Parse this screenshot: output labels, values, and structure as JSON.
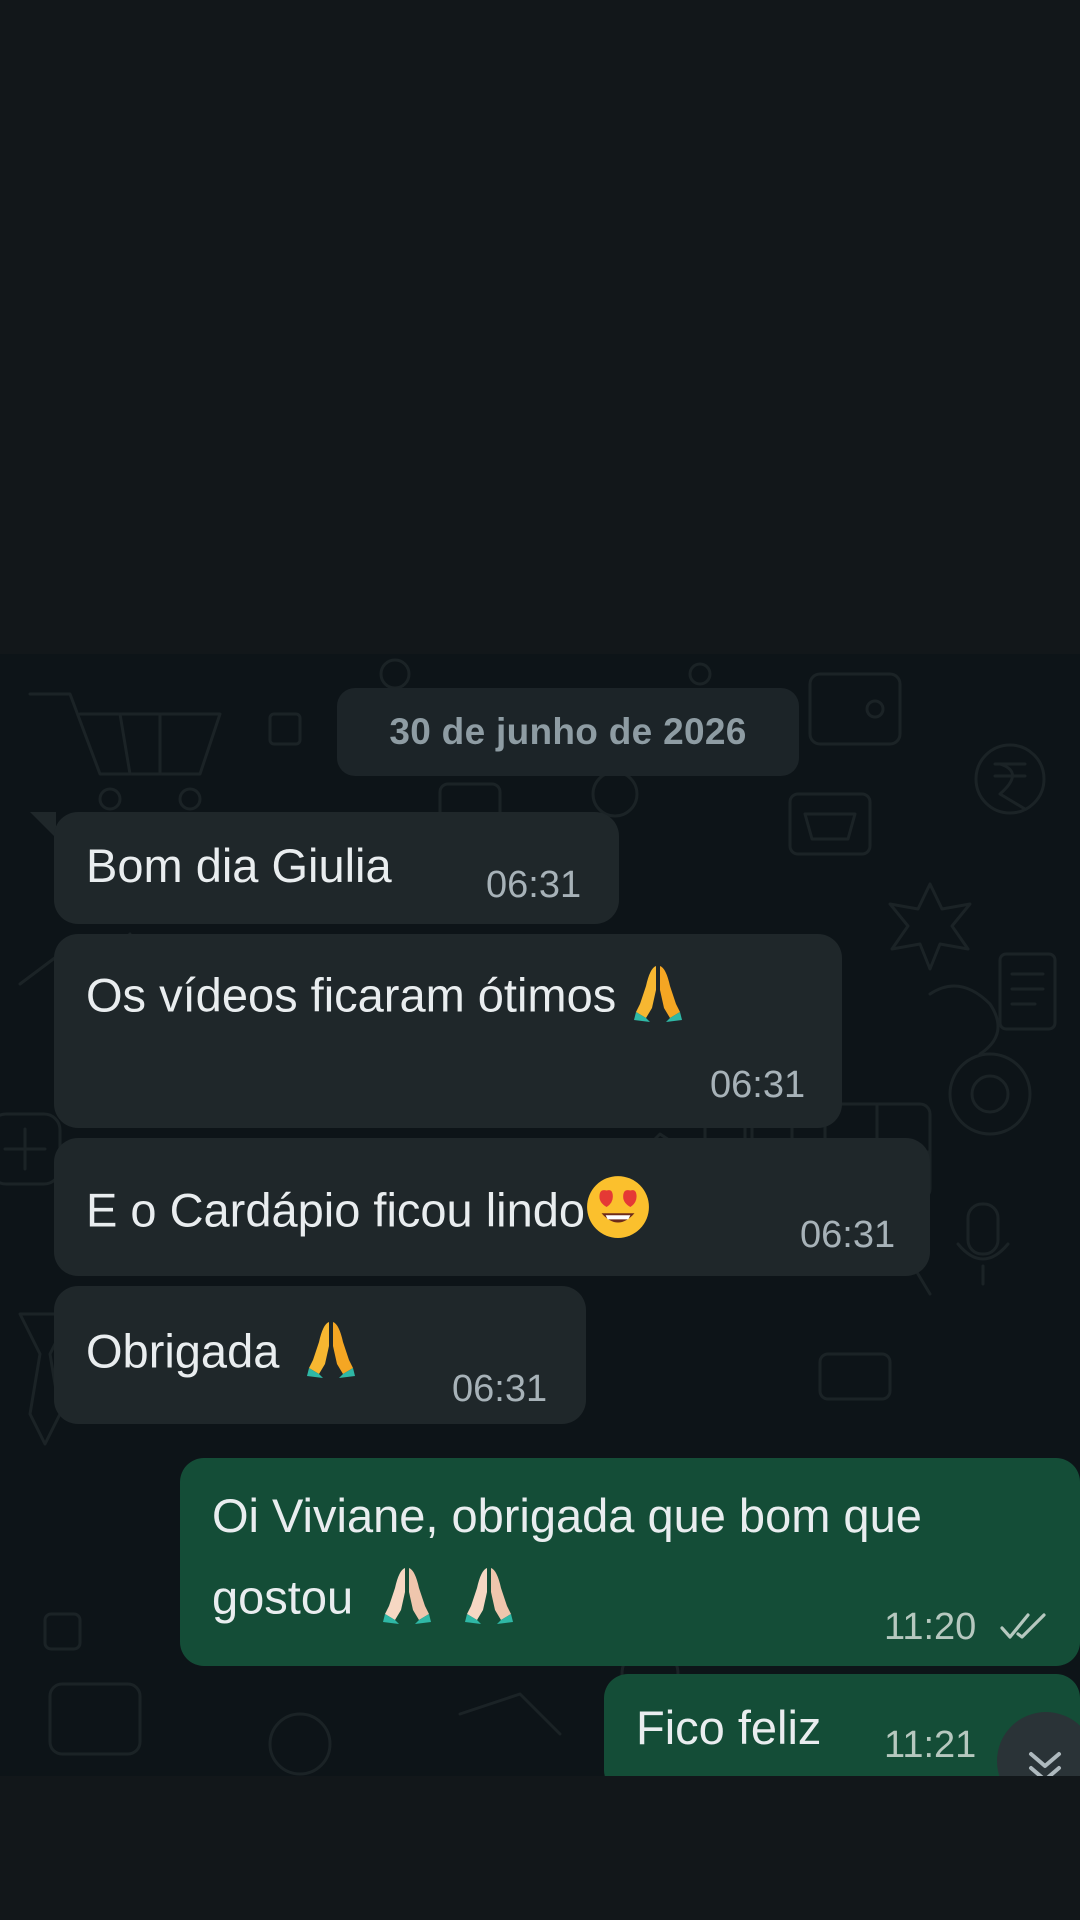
{
  "chat": {
    "date_chip": "30 de junho de 2026",
    "messages": [
      {
        "direction": "in",
        "text": "Bom dia Giulia",
        "time": "06:31"
      },
      {
        "direction": "in",
        "text": "Os vídeos ficaram ótimos",
        "emoji": "folded-hands-emoji",
        "time": "06:31"
      },
      {
        "direction": "in",
        "text": "E o Cardápio ficou lindo",
        "emoji": "heart-eyes-emoji",
        "time": "06:31"
      },
      {
        "direction": "in",
        "text": "Obrigada",
        "emoji": "folded-hands-emoji",
        "time": "06:31"
      },
      {
        "direction": "out",
        "text_line1": "Oi Viviane, obrigada que bom que",
        "text_line2": "gostou",
        "emoji": "folded-hands-light-emoji x2",
        "time": "11:20",
        "status": "read"
      },
      {
        "direction": "out",
        "text": "Fico feliz",
        "time": "11:21"
      }
    ]
  },
  "colors": {
    "background": "#0d1418",
    "incoming_bubble": "#1f272a",
    "outgoing_bubble": "#144d37",
    "text": "#e9edef",
    "read_ticks": "#b6c8bf"
  }
}
